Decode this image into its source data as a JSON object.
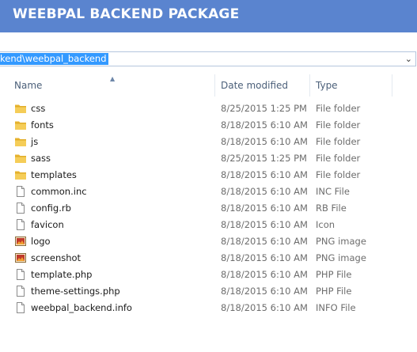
{
  "banner": {
    "title": "WEEBPAL BACKEND PACKAGE"
  },
  "address": {
    "path": "kend\\weebpal_backend",
    "dropdown_icon": "chevron-down-icon"
  },
  "columns": {
    "name": "Name",
    "date": "Date modified",
    "type": "Type"
  },
  "files": [
    {
      "name": "css",
      "date": "8/25/2015 1:25 PM",
      "type": "File folder",
      "icon": "folder-icon"
    },
    {
      "name": "fonts",
      "date": "8/18/2015 6:10 AM",
      "type": "File folder",
      "icon": "folder-icon"
    },
    {
      "name": "js",
      "date": "8/18/2015 6:10 AM",
      "type": "File folder",
      "icon": "folder-icon"
    },
    {
      "name": "sass",
      "date": "8/25/2015 1:25 PM",
      "type": "File folder",
      "icon": "folder-icon"
    },
    {
      "name": "templates",
      "date": "8/18/2015 6:10 AM",
      "type": "File folder",
      "icon": "folder-icon"
    },
    {
      "name": "common.inc",
      "date": "8/18/2015 6:10 AM",
      "type": "INC File",
      "icon": "file-icon"
    },
    {
      "name": "config.rb",
      "date": "8/18/2015 6:10 AM",
      "type": "RB File",
      "icon": "file-icon"
    },
    {
      "name": "favicon",
      "date": "8/18/2015 6:10 AM",
      "type": "Icon",
      "icon": "file-icon"
    },
    {
      "name": "logo",
      "date": "8/18/2015 6:10 AM",
      "type": "PNG image",
      "icon": "image-icon"
    },
    {
      "name": "screenshot",
      "date": "8/18/2015 6:10 AM",
      "type": "PNG image",
      "icon": "image-icon"
    },
    {
      "name": "template.php",
      "date": "8/18/2015 6:10 AM",
      "type": "PHP File",
      "icon": "file-icon"
    },
    {
      "name": "theme-settings.php",
      "date": "8/18/2015 6:10 AM",
      "type": "PHP File",
      "icon": "file-icon"
    },
    {
      "name": "weebpal_backend.info",
      "date": "8/18/2015 6:10 AM",
      "type": "INFO File",
      "icon": "file-icon"
    }
  ]
}
